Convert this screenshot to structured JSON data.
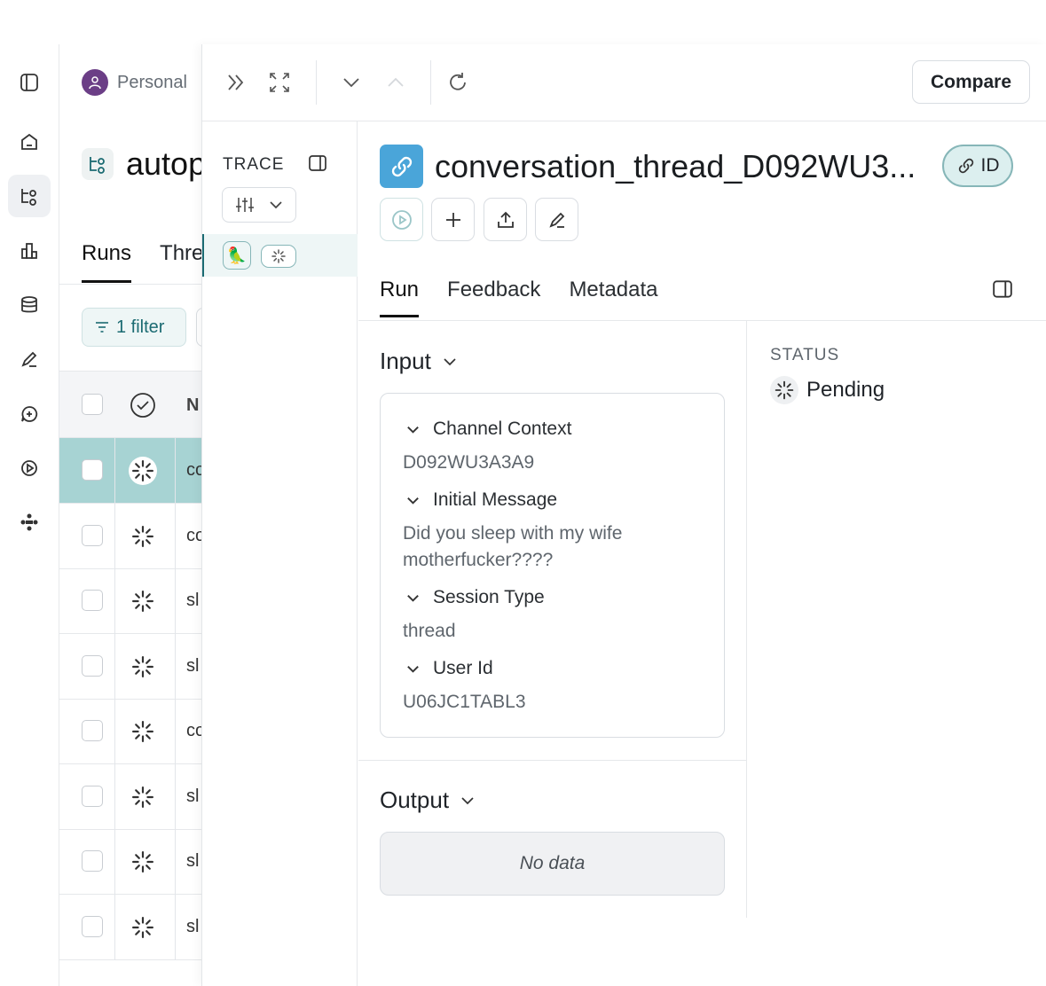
{
  "workspace": {
    "name": "Personal"
  },
  "project": {
    "title": "autop"
  },
  "list": {
    "tabs": [
      "Runs",
      "Thre"
    ],
    "filter_label": "1 filter",
    "column_header": "N",
    "rows": [
      "co",
      "co",
      "sl",
      "sl",
      "co",
      "sl",
      "sl",
      "sl"
    ]
  },
  "toolbar": {
    "compare_label": "Compare"
  },
  "trace": {
    "label": "TRACE",
    "item_emoji": "🦜"
  },
  "run": {
    "title": "conversation_thread_D092WU3...",
    "id_label": "ID",
    "tabs": [
      "Run",
      "Feedback",
      "Metadata"
    ],
    "input": {
      "title": "Input",
      "fields": [
        {
          "label": "Channel Context",
          "value": "D092WU3A3A9"
        },
        {
          "label": "Initial Message",
          "value": "Did you sleep with my wife motherfucker????"
        },
        {
          "label": "Session Type",
          "value": "thread"
        },
        {
          "label": "User Id",
          "value": "U06JC1TABL3"
        }
      ]
    },
    "output": {
      "title": "Output",
      "empty_text": "No data"
    },
    "status": {
      "label": "STATUS",
      "value": "Pending"
    }
  },
  "colors": {
    "accent": "#1b6b72",
    "run_icon": "#4aa5d9",
    "selected_row": "#a7d3d3"
  }
}
